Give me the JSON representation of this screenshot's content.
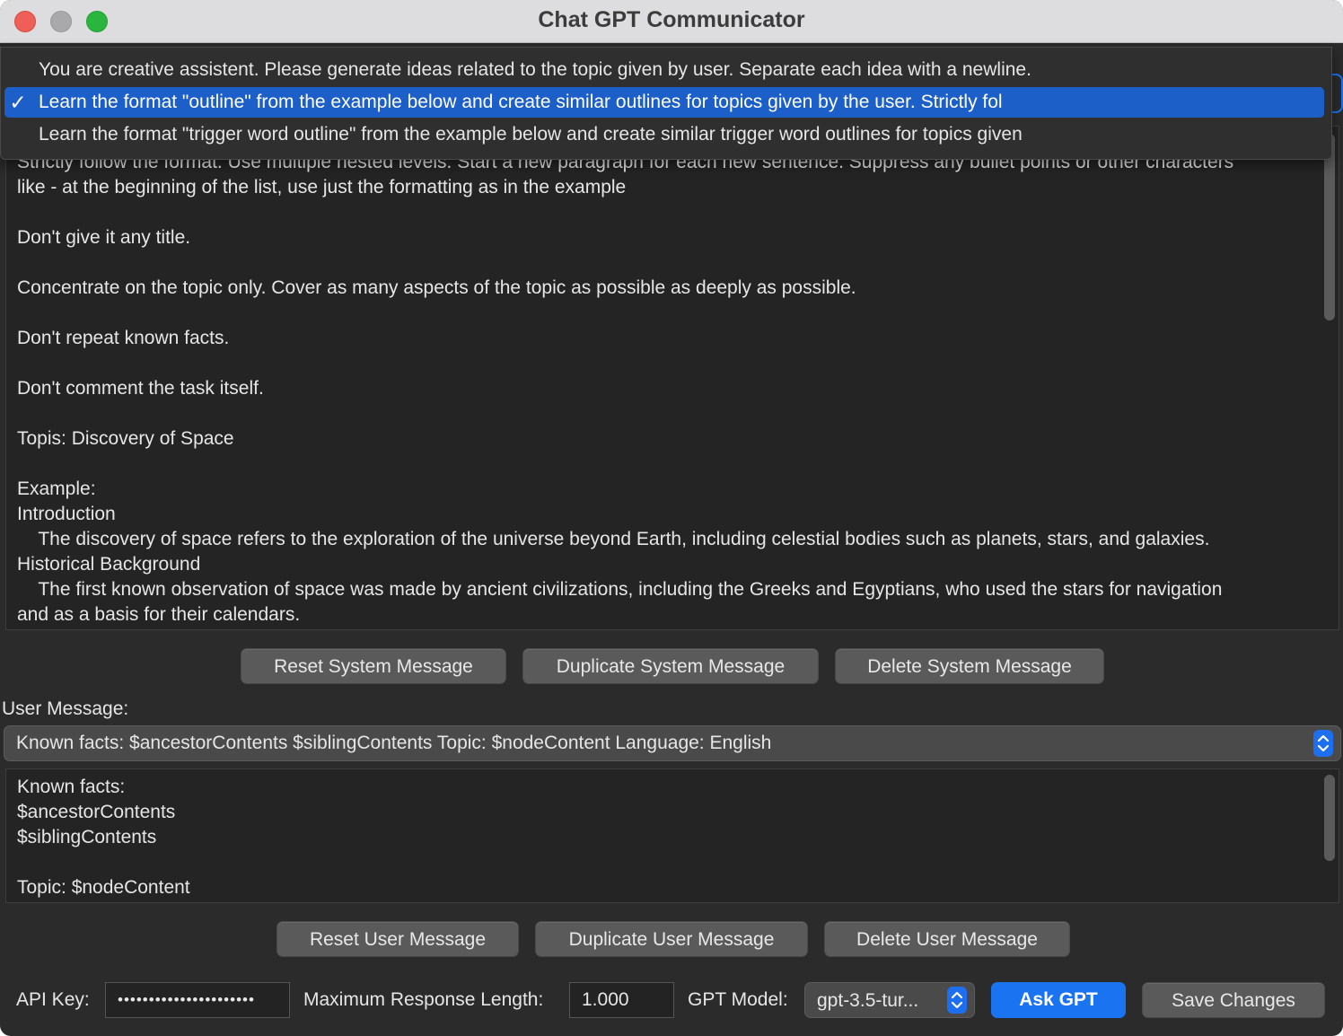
{
  "window": {
    "title": "Chat GPT Communicator"
  },
  "system_message": {
    "dropdown_options": [
      "You are creative assistent. Please generate ideas related to the topic given by user. Separate each idea with a newline.",
      "Learn the format \"outline\" from the example below and create similar outlines for topics given by the user. Strictly fol",
      "Learn the format \"trigger word outline\" from the example below and create similar trigger word outlines for topics given"
    ],
    "selected_check": "✓",
    "text": "Strictly follow the format. Use multiple nested levels. Start a new paragraph for each new sentence. Suppress any bullet points or other characters\nlike - at the beginning of the list, use just the formatting as in the example\n\nDon't give it any title.\n\nConcentrate on the topic only. Cover as many aspects of the topic as possible as deeply as possible.\n\nDon't repeat known facts.\n\nDon't comment the task itself.\n\nTopis: Discovery of Space\n\nExample:\nIntroduction\n    The discovery of space refers to the exploration of the universe beyond Earth, including celestial bodies such as planets, stars, and galaxies.\nHistorical Background\n    The first known observation of space was made by ancient civilizations, including the Greeks and Egyptians, who used the stars for navigation\nand as a basis for their calendars.",
    "buttons": {
      "reset": "Reset System Message",
      "duplicate": "Duplicate System Message",
      "delete": "Delete System Message"
    }
  },
  "user_message": {
    "label": "User Message:",
    "selected": "Known facts: $ancestorContents $siblingContents Topic: $nodeContent Language: English",
    "text": "Known facts:\n$ancestorContents\n$siblingContents\n\nTopic: $nodeContent",
    "buttons": {
      "reset": "Reset User Message",
      "duplicate": "Duplicate User Message",
      "delete": "Delete User Message"
    }
  },
  "footer": {
    "api_key_label": "API Key:",
    "api_key_value": "••••••••••••••••••••••",
    "max_length_label": "Maximum Response Length:",
    "max_length_value": "1.000",
    "model_label": "GPT Model:",
    "model_value": "gpt-3.5-tur...",
    "ask_button": "Ask GPT",
    "save_button": "Save Changes"
  },
  "colors": {
    "accent": "#1a73f0",
    "menu_highlight": "#1c5fc9",
    "background": "#2b2b2b"
  }
}
